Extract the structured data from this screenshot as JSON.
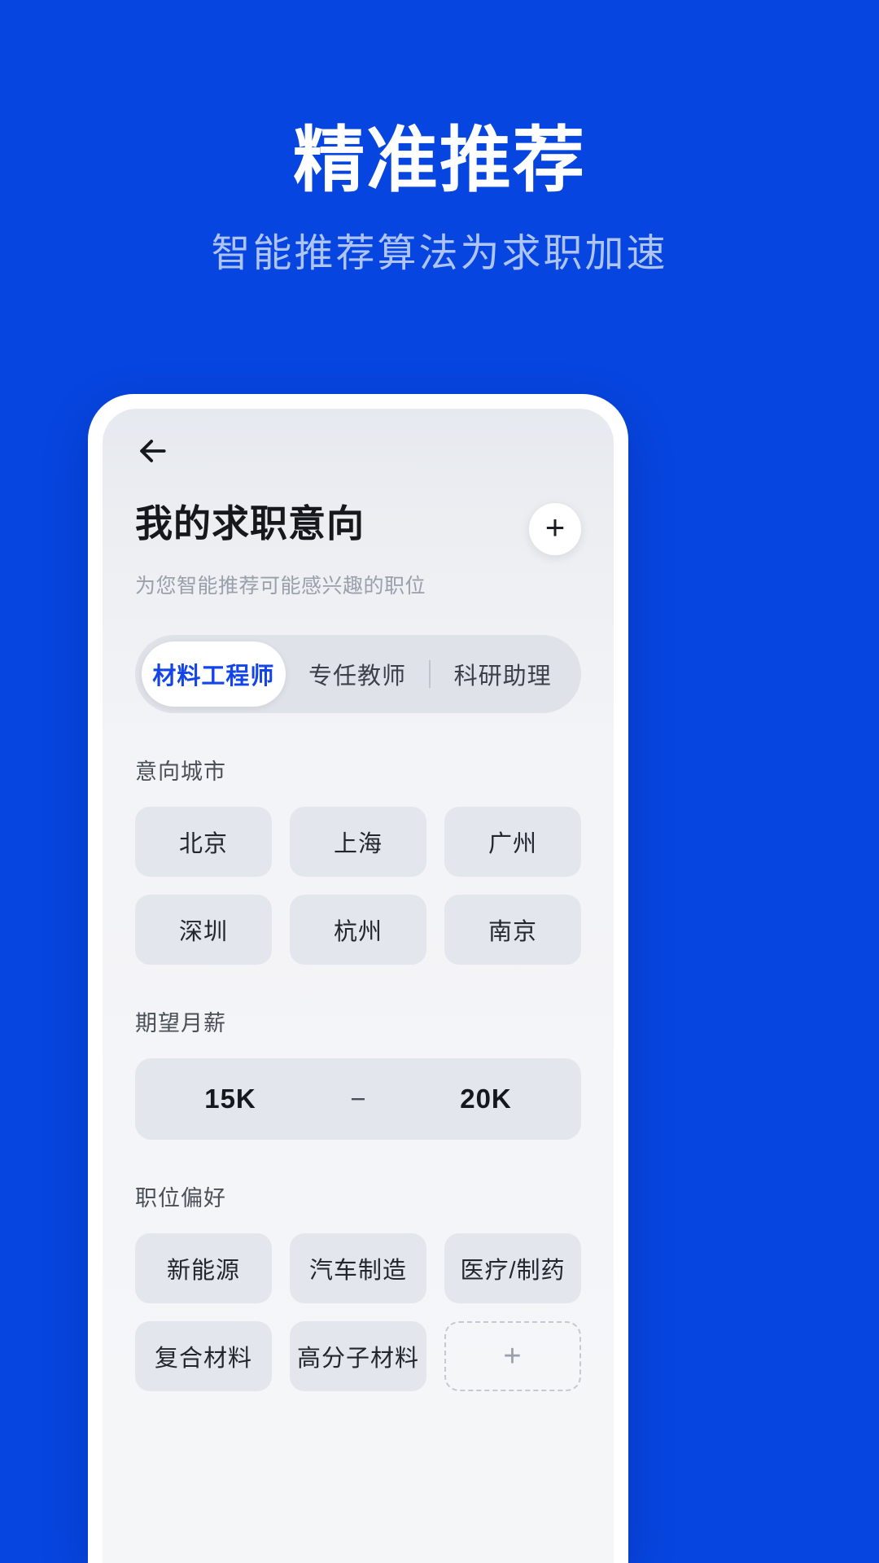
{
  "hero": {
    "title": "精准推荐",
    "subtitle": "智能推荐算法为求职加速"
  },
  "colors": {
    "background": "#0745e0",
    "accent": "#1344e8",
    "subtitle": "#aec4f4",
    "chip": "#e3e6ec",
    "screen": "#f3f4f7"
  },
  "app": {
    "back_icon": "arrow-left-icon",
    "page_title": "我的求职意向",
    "page_subtitle": "为您智能推荐可能感兴趣的职位",
    "add_label": "+",
    "tabs": [
      {
        "label": "材料工程师",
        "active": true
      },
      {
        "label": "专任教师",
        "active": false
      },
      {
        "label": "科研助理",
        "active": false
      }
    ],
    "sections": [
      {
        "label": "意向城市",
        "chips": [
          "北京",
          "上海",
          "广州",
          "深圳",
          "杭州",
          "南京"
        ]
      }
    ],
    "salary": {
      "label": "期望月薪",
      "min": "15K",
      "separator": "−",
      "max": "20K"
    },
    "preference": {
      "label": "职位偏好",
      "chips": [
        "新能源",
        "汽车制造",
        "医疗/制药",
        "复合材料",
        "高分子材料"
      ],
      "add_label": "+"
    }
  }
}
